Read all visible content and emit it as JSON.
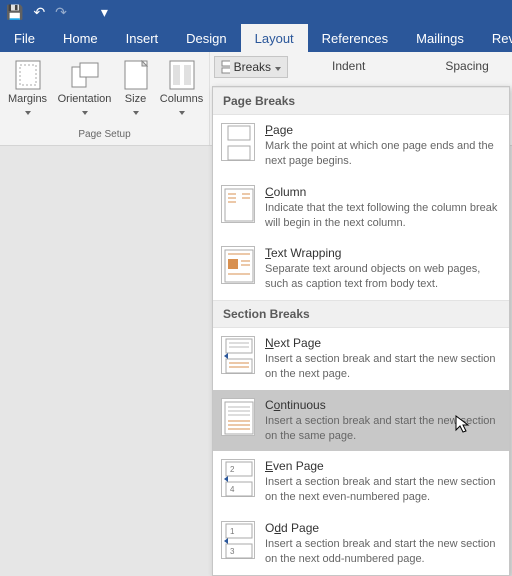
{
  "titlebar": {
    "save": "💾",
    "undo": "↶",
    "redo": "↷",
    "more": "▾"
  },
  "menubar": {
    "tabs": [
      {
        "label": "File"
      },
      {
        "label": "Home"
      },
      {
        "label": "Insert"
      },
      {
        "label": "Design"
      },
      {
        "label": "Layout"
      },
      {
        "label": "References"
      },
      {
        "label": "Mailings"
      },
      {
        "label": "Revie"
      }
    ],
    "active_index": 4
  },
  "ribbon": {
    "page_setup_group": {
      "margins": "Margins",
      "orientation": "Orientation",
      "size": "Size",
      "columns": "Columns",
      "group_label": "Page Setup"
    },
    "breaks_btn": "Breaks",
    "indent_label": "Indent",
    "spacing_label": "Spacing"
  },
  "dropdown": {
    "page_breaks_header": "Page Breaks",
    "section_breaks_header": "Section Breaks",
    "items": {
      "page": {
        "title_pre": "",
        "title_ul": "P",
        "title_post": "age",
        "desc": "Mark the point at which one page ends and the next page begins."
      },
      "column": {
        "title_pre": "",
        "title_ul": "C",
        "title_post": "olumn",
        "desc": "Indicate that the text following the column break will begin in the next column."
      },
      "textwrap": {
        "title_pre": "",
        "title_ul": "T",
        "title_post": "ext Wrapping",
        "desc": "Separate text around objects on web pages, such as caption text from body text."
      },
      "nextpage": {
        "title_pre": "",
        "title_ul": "N",
        "title_post": "ext Page",
        "desc": "Insert a section break and start the new section on the next page."
      },
      "continuous": {
        "title_pre": "C",
        "title_ul": "o",
        "title_post": "ntinuous",
        "desc": "Insert a section break and start the new section on the same page."
      },
      "evenpage": {
        "title_pre": "",
        "title_ul": "E",
        "title_post": "ven Page",
        "desc": "Insert a section break and start the new section on the next even-numbered page."
      },
      "oddpage": {
        "title_pre": "O",
        "title_ul": "d",
        "title_post": "d Page",
        "desc": "Insert a section break and start the new section on the next odd-numbered page."
      }
    }
  }
}
